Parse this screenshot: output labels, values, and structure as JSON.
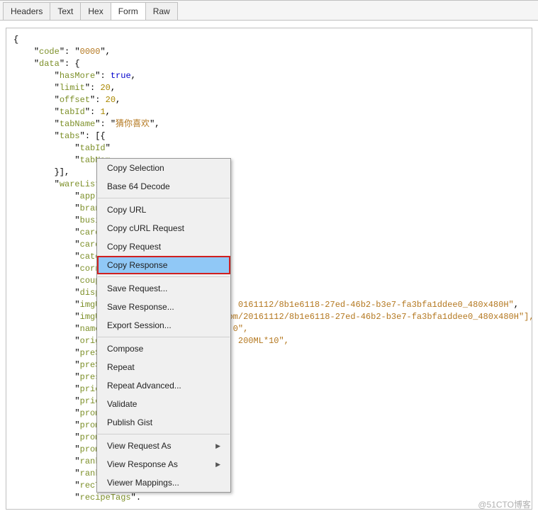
{
  "tabs": {
    "headers": "Headers",
    "text": "Text",
    "hex": "Hex",
    "form": "Form",
    "raw": "Raw"
  },
  "json_response": {
    "code_key": "code",
    "code_val": "0000",
    "data_key": "data",
    "hasMore_key": "hasMore",
    "hasMore_val": "true",
    "limit_key": "limit",
    "limit_val": "20",
    "offset_key": "offset",
    "offset_val": "20",
    "tabId_key": "tabId",
    "tabId_val": "1",
    "tabName_key": "tabName",
    "tabName_val": "猜你喜欢",
    "tabs_key": "tabs",
    "inner_tabId_key": "tabId",
    "inner_tabNam_key": "tabNam",
    "wareList_key": "wareList",
    "applau_key": "applau",
    "brandI_key": "brandI",
    "busine_key": "busine",
    "cardDe_key": "cardDe",
    "cardTi_key": "cardTi",
    "catego_key": "catego",
    "corner_key": "corner",
    "coupon_key": "coupon",
    "displa_key": "displa",
    "imgUrl_key": "imgUrl",
    "imgUrl_tail1": "0161112/8b1e6118-27ed-46b2-b3e7-fa3bfa1ddee0_480x480H\"",
    "imgUrl_key2": "imgUrl",
    "imgUrl_tail2": "om/20161112/8b1e6118-27ed-46b2-b3e7-fa3bfa1ddee0_480x480H\"],",
    "name_key": "name",
    "name_tail": "0\",",
    "origin_key": "origin",
    "origin_tail": " 200ML*10\",",
    "preSal_key": "preSal",
    "preSal_key2": "preSal",
    "presal_key": "presal",
    "priceD_key": "priceD",
    "priceD_key2": "priceD",
    "promot_key": "promot",
    "promot_key2": "promot",
    "promot_key3": "promot",
    "promot_key4": "promot",
    "rankTa_key": "rankTa",
    "rankUr_key": "rankUr",
    "recTag_key": "recTag",
    "recipe_key": "recipeTags"
  },
  "menu": {
    "copy_selection": "Copy Selection",
    "base64_decode": "Base 64 Decode",
    "copy_url": "Copy URL",
    "copy_curl": "Copy cURL Request",
    "copy_request": "Copy Request",
    "copy_response": "Copy Response",
    "save_request": "Save Request...",
    "save_response": "Save Response...",
    "export_session": "Export Session...",
    "compose": "Compose",
    "repeat": "Repeat",
    "repeat_advanced": "Repeat Advanced...",
    "validate": "Validate",
    "publish_gist": "Publish Gist",
    "view_request_as": "View Request As",
    "view_response_as": "View Response As",
    "viewer_mappings": "Viewer Mappings..."
  },
  "watermark": "@51CTO博客"
}
